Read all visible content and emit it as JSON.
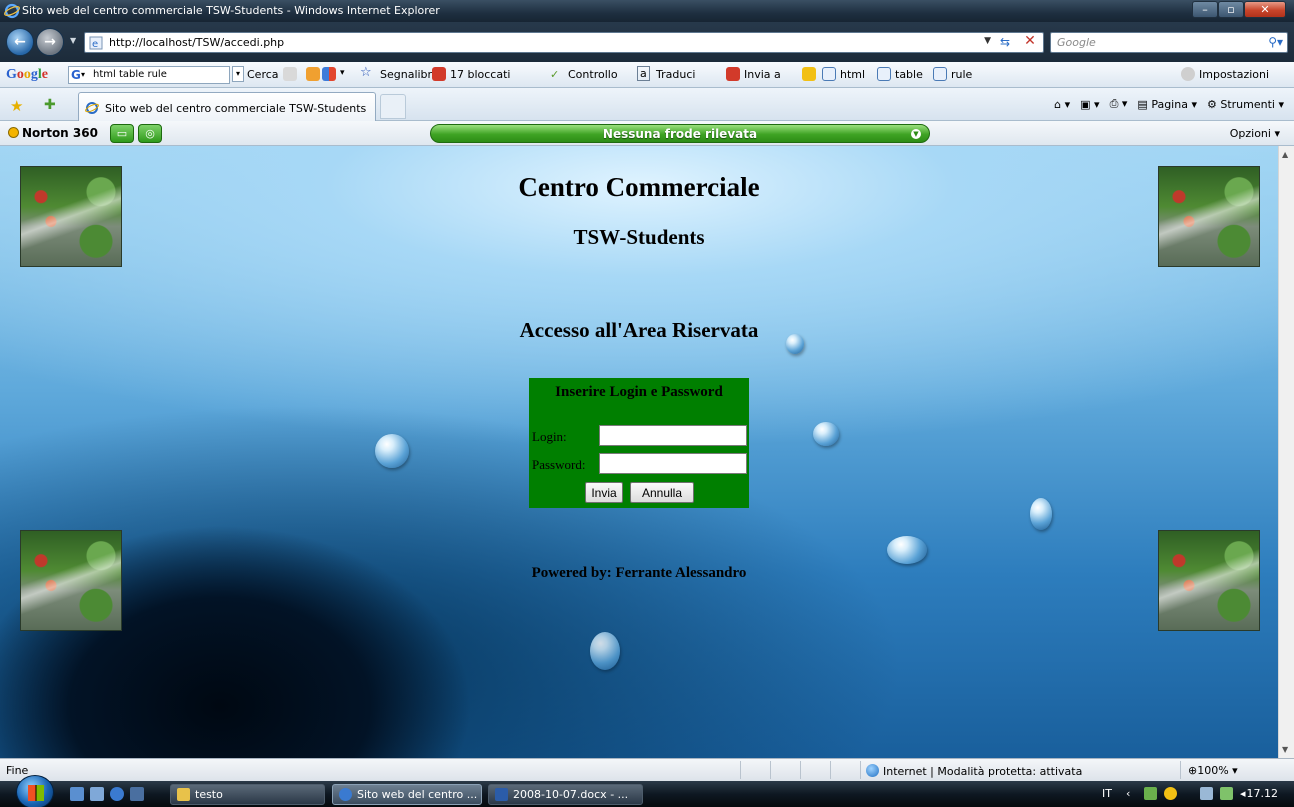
{
  "window": {
    "title": "Sito web del centro commerciale TSW-Students - Windows Internet Explorer"
  },
  "address_bar": {
    "url": "http://localhost/TSW/accedi.php",
    "search_placeholder": "Google"
  },
  "google_toolbar": {
    "search_value": "html table rule",
    "cerca": "Cerca",
    "segnalibri": "Segnalibri",
    "bloccati": "17 bloccati",
    "controllo": "Controllo",
    "traduci": "Traduci",
    "invia_a": "Invia a",
    "term1": "html",
    "term2": "table",
    "term3": "rule",
    "impostazioni": "Impostazioni"
  },
  "tab": {
    "label": "Sito web del centro commerciale TSW-Students"
  },
  "command_bar": {
    "pagina": "Pagina",
    "strumenti": "Strumenti"
  },
  "norton": {
    "name": "Norton 360",
    "status": "Nessuna frode rilevata",
    "opzioni": "Opzioni"
  },
  "page": {
    "title": "Centro Commerciale",
    "subtitle": "TSW-Students",
    "section": "Accesso all'Area Riservata",
    "login_box": {
      "heading": "Inserire Login e Password",
      "login_label": "Login:",
      "password_label": "Password:",
      "submit": "Invia",
      "reset": "Annulla"
    },
    "footer": "Powered by: Ferrante Alessandro"
  },
  "status_bar": {
    "text": "Fine",
    "zone": "Internet | Modalità protetta: attivata",
    "zoom": "100%"
  },
  "taskbar": {
    "items": [
      "testo",
      "Sito web del centro ...",
      "2008-10-07.docx - ..."
    ],
    "lang": "IT",
    "clock": "17.12"
  },
  "colors": {
    "login_box": "#007f00",
    "norton_status": "#3fa324",
    "titlebar": "#1e2f40"
  }
}
